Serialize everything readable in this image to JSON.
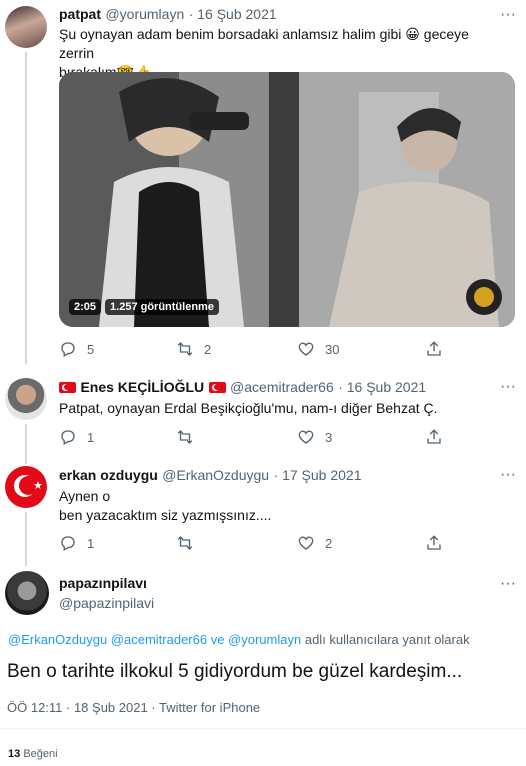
{
  "tweet1": {
    "name": "patpat",
    "handle": "@yorumlayn",
    "date": "· 16 Şub 2021",
    "text_before": "Şu oynayan adam benim borsadaki anlamsız halim gibi",
    "emoji1": "😀",
    "text_mid": "geceye zerrin",
    "text_line2": "bırakalım",
    "emoji2": "🤓👍",
    "video": {
      "duration": "2:05",
      "views": "1.257 görüntülenme"
    },
    "replies": "5",
    "retweets": "2",
    "likes": "30"
  },
  "tweet2": {
    "name": "Enes KEÇİLİOĞLU",
    "handle": "@acemitrader66",
    "date": "· 16 Şub 2021",
    "text": "Patpat, oynayan Erdal Beşikçioğlu'mu, nam-ı diğer Behzat Ç.",
    "replies": "1",
    "retweets": "",
    "likes": "3"
  },
  "tweet3": {
    "name": "erkan ozduygu",
    "handle": "@ErkanOzduygu",
    "date": "· 17 Şub 2021",
    "line1": "Aynen o",
    "line2": "ben yazacaktım siz yazmışsınız....",
    "replies": "1",
    "retweets": "",
    "likes": "2"
  },
  "main": {
    "name": "papazınpilavı",
    "handle": "@papazinpilavi",
    "reply_users": "@ErkanOzduygu @acemitrader66 ve @yorumlayn",
    "reply_suffix": "adlı kullanıcılara yanıt olarak",
    "text": "Ben o tarihte ilkokul 5 gidiyordum be güzel kardeşim...",
    "time": "ÖÖ 12:11 · 18 Şub 2021 · Twitter for iPhone",
    "likes_count": "13",
    "likes_label": "Beğeni"
  },
  "colors": {
    "link": "#1d9bf0",
    "muted": "#536471",
    "text": "#0f1419",
    "divider": "#eff3f4"
  }
}
